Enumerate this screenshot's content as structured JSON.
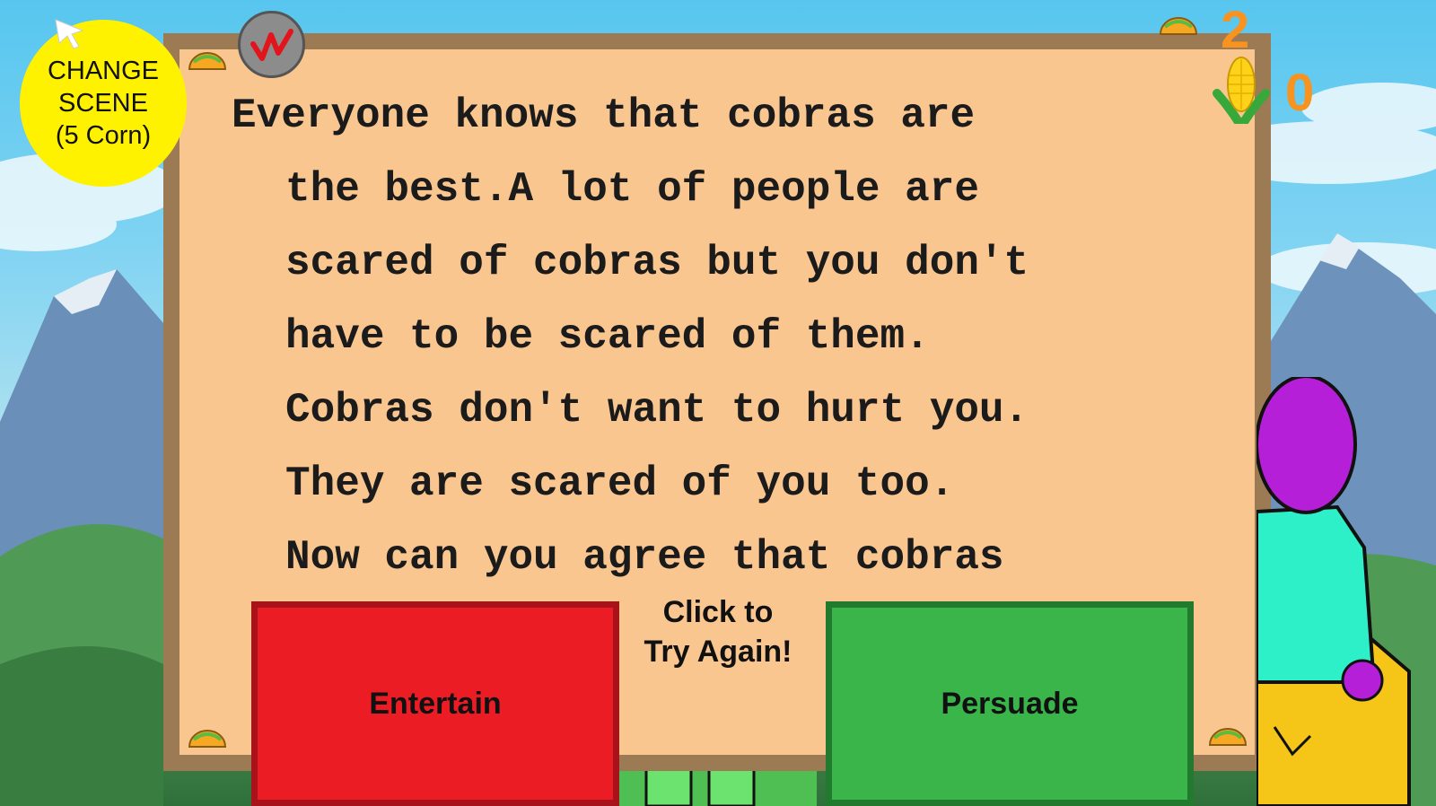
{
  "hud": {
    "change_scene_lines": [
      "CHANGE",
      "SCENE",
      "(5 Corn)"
    ],
    "counter_top": "2",
    "counter_bottom": "0"
  },
  "story": {
    "lines": [
      "Everyone knows that cobras are",
      "the best.A lot of people are",
      "scared of cobras but you don't",
      "have to be scared of them.",
      "Cobras don't want to hurt you.",
      "They are scared of you too.",
      "Now can you agree that cobras"
    ]
  },
  "feedback": {
    "retry_lines": [
      "Click to",
      "Try Again!"
    ]
  },
  "buttons": {
    "entertain": "Entertain",
    "persuade": "Persuade"
  },
  "colors": {
    "sky": "#57c6ef",
    "board": "#fac690",
    "board_frame": "#9c7a54",
    "entertain": "#ec1c24",
    "persuade": "#39b54a",
    "change_scene": "#fff200",
    "counter": "#f7931e",
    "character_head": "#b51fd8",
    "character_shirt": "#2ef0c8",
    "character_pants": "#f5c518"
  }
}
